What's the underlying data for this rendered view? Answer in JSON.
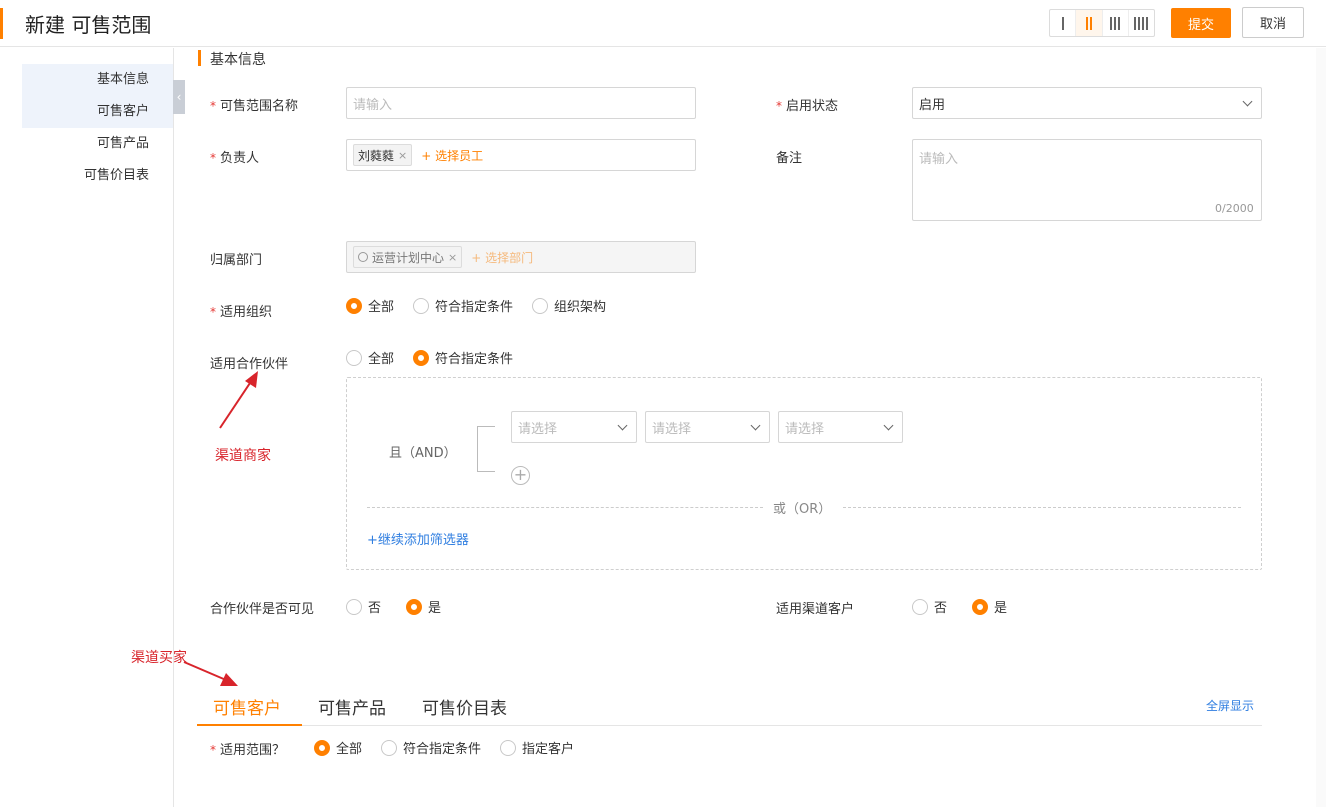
{
  "header": {
    "title": "新建 可售范围",
    "submit_label": "提交",
    "cancel_label": "取消",
    "column_options": [
      "I",
      "II",
      "III",
      "IIII"
    ],
    "active_column_option": "II"
  },
  "sidenav": {
    "items": [
      {
        "label": "基本信息"
      },
      {
        "label": "可售客户"
      },
      {
        "label": "可售产品"
      },
      {
        "label": "可售价目表"
      }
    ]
  },
  "section": {
    "title": "基本信息"
  },
  "form": {
    "range_name": {
      "label": "可售范围名称",
      "placeholder": "请输入"
    },
    "status": {
      "label": "启用状态",
      "value": "启用"
    },
    "owner": {
      "label": "负责人",
      "tag": "刘蕤蕤",
      "tag_close": "×",
      "add_label": "+ 选择员工"
    },
    "remark": {
      "label": "备注",
      "placeholder": "请输入",
      "counter": "0/2000"
    },
    "department": {
      "label": "归属部门",
      "tag": "运营计划中心",
      "tag_close": "×",
      "add_label": "+ 选择部门"
    },
    "org": {
      "label": "适用组织",
      "options": [
        "全部",
        "符合指定条件",
        "组织架构"
      ],
      "selected": "全部"
    },
    "partner": {
      "label": "适用合作伙伴",
      "options": [
        "全部",
        "符合指定条件"
      ],
      "selected": "符合指定条件"
    },
    "filter": {
      "and_label": "且（AND）",
      "select_placeholder": "请选择",
      "or_label": "或（OR）",
      "add_filter_label": "+继续添加筛选器",
      "plus_glyph": "+"
    },
    "partner_visible": {
      "label": "合作伙伴是否可见",
      "options": [
        "否",
        "是"
      ],
      "selected": "是"
    },
    "channel_customer": {
      "label": "适用渠道客户",
      "options": [
        "否",
        "是"
      ],
      "selected": "是"
    }
  },
  "annotations": {
    "channel_merchant": "渠道商家",
    "channel_buyer": "渠道买家"
  },
  "tabs": {
    "items": [
      "可售客户",
      "可售产品",
      "可售价目表"
    ],
    "active": "可售客户",
    "fullscreen_label": "全屏显示"
  },
  "scope": {
    "label": "适用范围？",
    "options": [
      "全部",
      "符合指定条件",
      "指定客户"
    ],
    "selected": "全部"
  },
  "colors": {
    "accent": "#ff8000",
    "link": "#2f7ee0",
    "annotation": "#d8242b"
  }
}
